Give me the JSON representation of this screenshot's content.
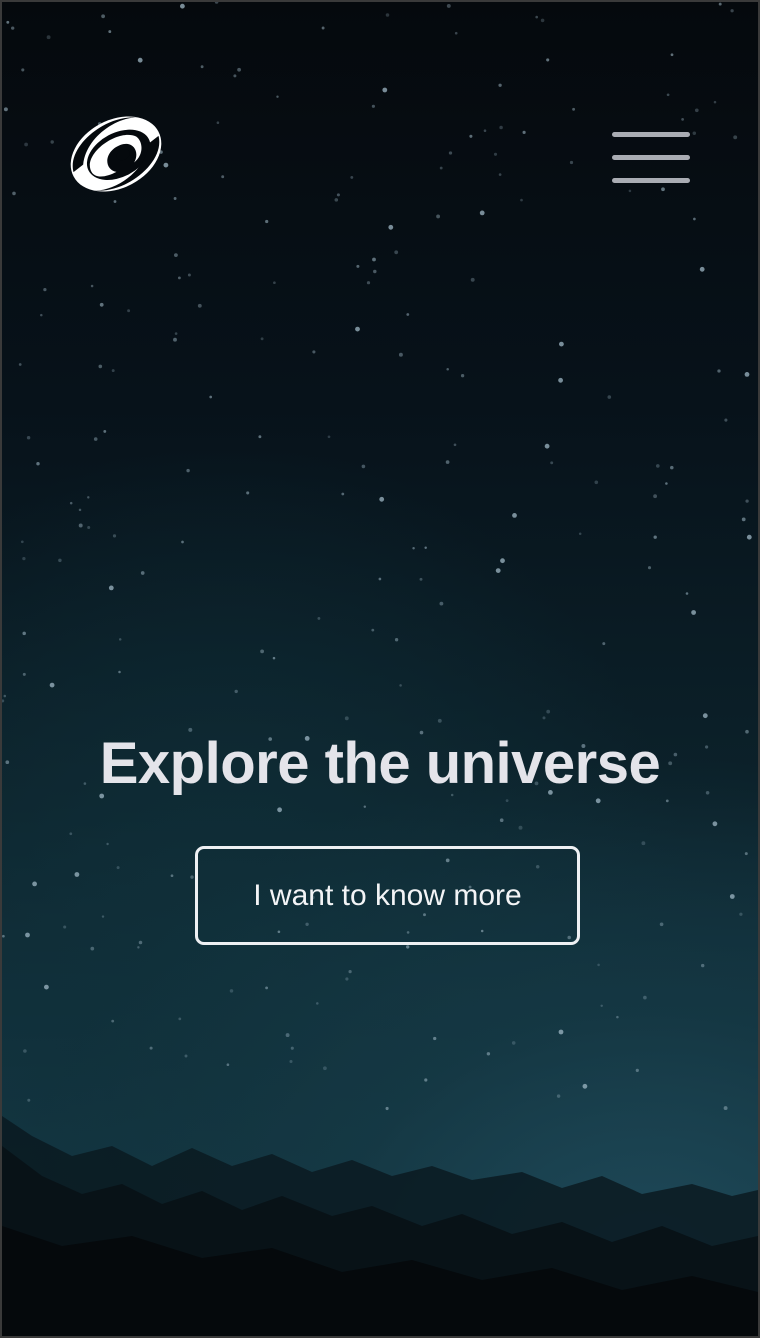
{
  "header": {
    "logo_icon": "swirl-galaxy-logo-icon",
    "menu_icon": "hamburger-menu-icon"
  },
  "hero": {
    "title": "Explore the universe",
    "cta_label": "I want to know more"
  },
  "colors": {
    "sky_top": "#05090d",
    "sky_bottom": "#173f4c",
    "text": "#e4e4ea",
    "button_border": "#eef0f3",
    "menu_bars": "#a9acb3"
  }
}
